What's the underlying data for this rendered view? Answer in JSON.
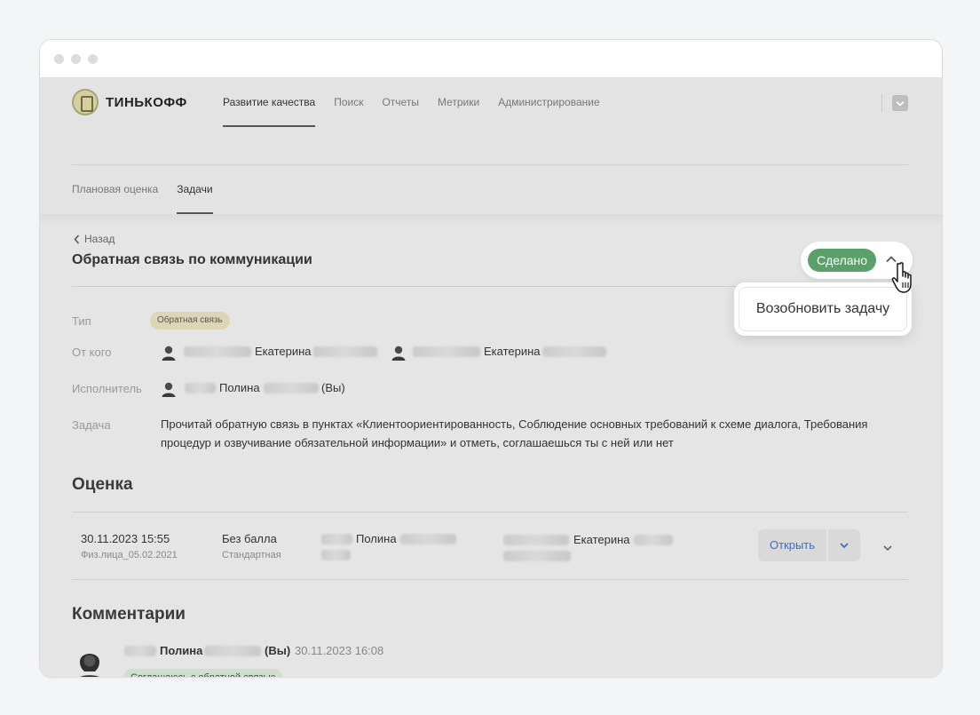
{
  "header": {
    "logo_text": "ТИНЬКОФФ",
    "nav": [
      {
        "label": "Развитие качества"
      },
      {
        "label": "Поиск"
      },
      {
        "label": "Отчеты"
      },
      {
        "label": "Метрики"
      },
      {
        "label": "Администрирование"
      }
    ],
    "subnav": [
      {
        "label": "Плановая оценка"
      },
      {
        "label": "Задачи"
      }
    ]
  },
  "page": {
    "back_label": "Назад",
    "title": "Обратная связь по коммуникации",
    "status": {
      "label": "Сделано",
      "color": "#5aa06a"
    },
    "status_menu": {
      "item": "Возобновить задачу"
    }
  },
  "info": {
    "type_label": "Тип",
    "type_value": "Обратная связь",
    "from_label": "От кого",
    "from_people": [
      "Екатерина",
      "Екатерина"
    ],
    "assignee_label": "Исполнитель",
    "assignee_name": "Полина",
    "assignee_suffix": "(Вы)",
    "task_label": "Задача",
    "task_text": "Прочитай обратную связь в пунктах «Клиентоориентированность, Соблюдение основных требований к схеме диалога, Требования процедур и озвучивание обязательной информации» и отметь, соглашаешься ты с ней или нет"
  },
  "evaluation": {
    "title": "Оценка",
    "row": {
      "datetime": "30.11.2023 15:55",
      "subtitle": "Физ.лица_05.02.2021",
      "score": "Без балла",
      "score_type": "Стандартная",
      "person1": "Полина",
      "person2": "Екатерина",
      "open_label": "Открыть"
    }
  },
  "comments": {
    "title": "Комментарии",
    "items": [
      {
        "author": "Полина",
        "suffix": "(Вы)",
        "timestamp": "30.11.2023 16:08",
        "badge": "Соглашаюсь с обратной связью"
      }
    ]
  }
}
